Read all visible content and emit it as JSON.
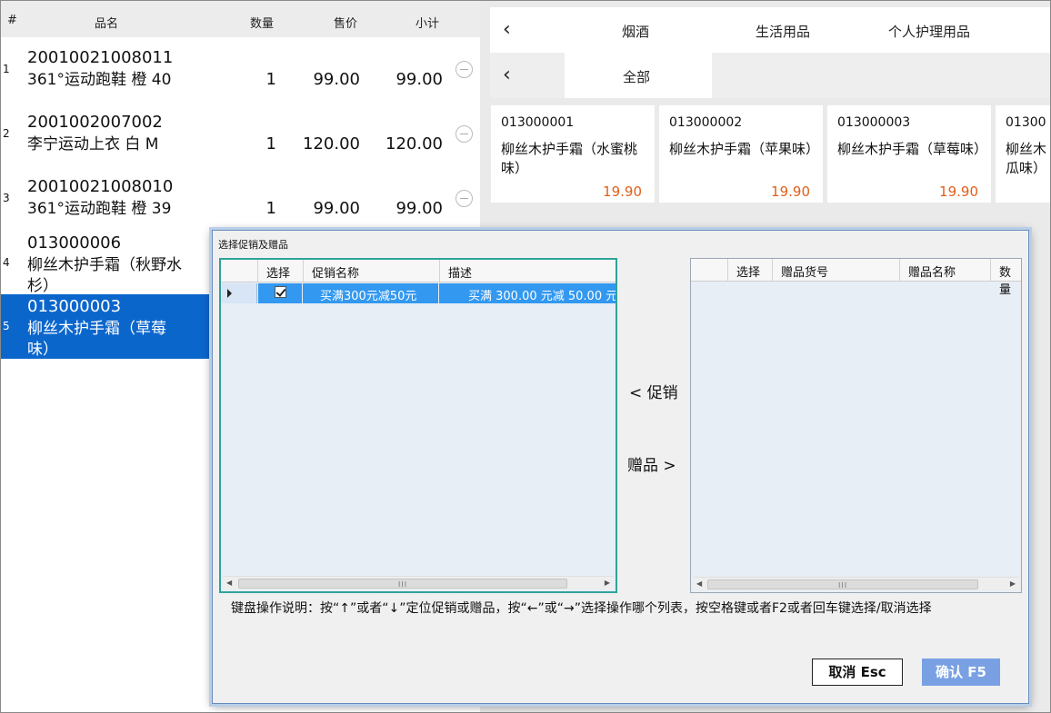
{
  "cart": {
    "headers": {
      "index": "#",
      "name": "品名",
      "qty": "数量",
      "price": "售价",
      "subtotal": "小计"
    },
    "rows": [
      {
        "index": "1",
        "code": "20010021008011",
        "name": "361°运动跑鞋 橙 40",
        "qty": "1",
        "price": "99.00",
        "subtotal": "99.00"
      },
      {
        "index": "2",
        "code": "2001002007002",
        "name": "李宁运动上衣 白 M",
        "qty": "1",
        "price": "120.00",
        "subtotal": "120.00"
      },
      {
        "index": "3",
        "code": "20010021008010",
        "name": "361°运动跑鞋 橙 39",
        "qty": "1",
        "price": "99.00",
        "subtotal": "99.00"
      },
      {
        "index": "4",
        "code": "013000006",
        "name_line1": "柳丝木护手霜（秋野水",
        "name_line2": "杉）"
      },
      {
        "index": "5",
        "code": "013000003",
        "name_line1": "柳丝木护手霜（草莓",
        "name_line2": "味）"
      }
    ]
  },
  "catalog": {
    "tabs": [
      "烟酒",
      "生活用品",
      "个人护理用品"
    ],
    "subtabs": [
      "全部"
    ],
    "back_icon": "chevron-left-icon",
    "products": [
      {
        "code": "013000001",
        "name": "柳丝木护手霜（水蜜桃味）",
        "price": "19.90"
      },
      {
        "code": "013000002",
        "name": "柳丝木护手霜（苹果味）",
        "price": "19.90"
      },
      {
        "code": "013000003",
        "name": "柳丝木护手霜（草莓味）",
        "price": "19.90"
      },
      {
        "code": "01300",
        "name_line1": "柳丝木",
        "name_line2": "瓜味）"
      }
    ],
    "price_color": "#e0601a"
  },
  "dialog": {
    "title": "选择促销及赠品",
    "promo_grid": {
      "headers": [
        "选择",
        "促销名称",
        "描述"
      ],
      "row": {
        "name": "买满300元减50元",
        "desc": "买满 300.00 元减 50.00 元"
      }
    },
    "gift_grid": {
      "headers": [
        "选择",
        "赠品货号",
        "赠品名称",
        "数量"
      ]
    },
    "btn_promo": "< 促销",
    "btn_gift": "赠品 >",
    "help_text": "键盘操作说明：按“↑”或者“↓”定位促销或赠品，按“←”或“→”选择操作哪个列表，按空格键或者F2或者回车键选择/取消选择",
    "cancel_label": "取消 Esc",
    "confirm_label": "确认 F5",
    "scroll_grip": "III"
  }
}
